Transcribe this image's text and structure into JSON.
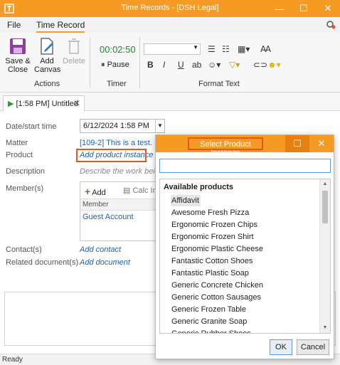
{
  "window": {
    "title": "Time Records - [DSH Legal]",
    "minimize": "—",
    "maximize": "☐",
    "close": "✕"
  },
  "menu": {
    "file": "File",
    "time_record": "Time Record"
  },
  "ribbon": {
    "save_close": [
      "Save &",
      "Close"
    ],
    "add_canvas": [
      "Add",
      "Canvas"
    ],
    "delete": "Delete",
    "actions_label": "Actions",
    "timer_value": "00:02:50",
    "pause": "Pause",
    "timer_label": "Timer",
    "format_label": "Format Text"
  },
  "doc_tab": {
    "label": "[1:58 PM] Untitled"
  },
  "form": {
    "date_label": "Date/start time",
    "date_value": "6/12/2024 1:58 PM",
    "matter_label": "Matter",
    "matter_value": "[109-2] This is a test.",
    "product_label": "Product",
    "product_link": "Add product instance",
    "description_label": "Description",
    "description_placeholder": "Describe the work being",
    "members_label": "Member(s)",
    "members_add": "Add",
    "members_calc": "Calc Inte",
    "members_col": "Member",
    "members_rows": [
      "Guest Account"
    ],
    "contacts_label": "Contact(s)",
    "contacts_link": "Add contact",
    "related_label": "Related document(s)",
    "related_link": "Add document"
  },
  "status": "Ready",
  "dialog": {
    "title": "Select Product Instance",
    "search_value": "",
    "list_header": "Available products",
    "items": [
      "Affidavit",
      "Awesome Fresh Pizza",
      "Ergonomic Frozen Chips",
      "Ergonomic Frozen Shirt",
      "Ergonomic Plastic Cheese",
      "Fantastic Cotton Shoes",
      "Fantastic Plastic Soap",
      "Generic Concrete Chicken",
      "Generic Cotton Sausages",
      "Generic Frozen Table",
      "Generic Granite Soap",
      "Generic Rubber Shoes"
    ],
    "selected_index": 0,
    "ok": "OK",
    "cancel": "Cancel"
  },
  "colors": {
    "accent": "#f59b24",
    "highlight": "#e8561a",
    "link": "#1f5fb0",
    "timer": "#1e8a2e"
  }
}
